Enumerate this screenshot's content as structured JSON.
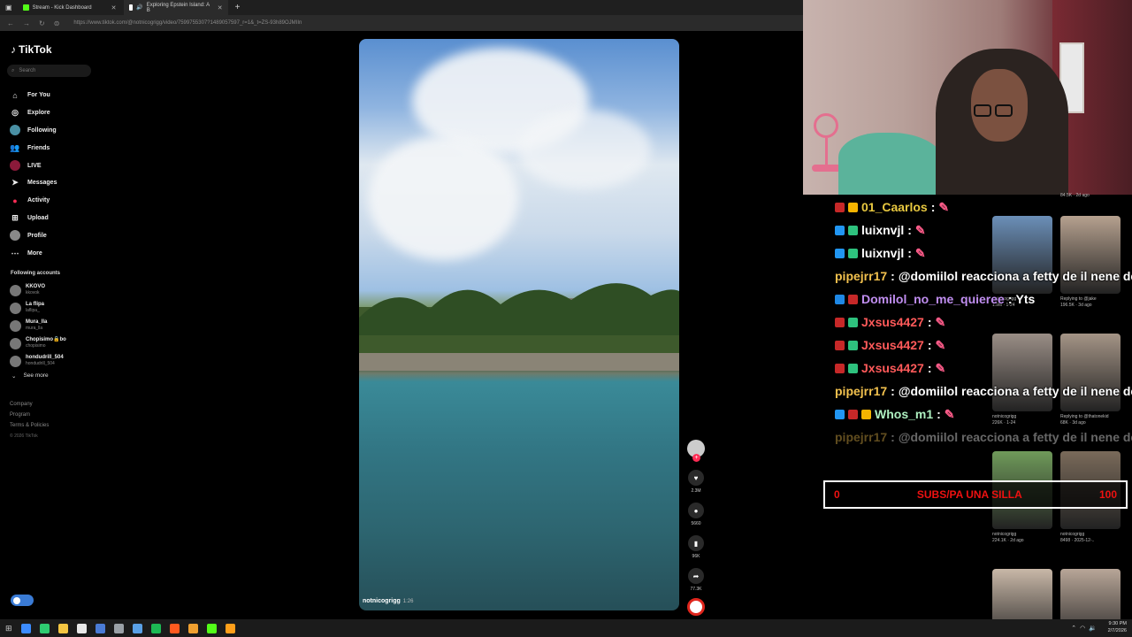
{
  "browser": {
    "tabs": [
      {
        "title": "Stream - Kick Dashboard",
        "fav_color": "#53fc18"
      },
      {
        "title": "Exploring Epstein Island: A B",
        "fav_color": "#ffffff"
      }
    ],
    "new_tab": "+",
    "url": "https://www.tiktok.com/@notnicogrigg/video/7599755307?1489057597_r=1&_t=ZS-93h89OJMIIn"
  },
  "tiktok": {
    "logo": "TikTok",
    "search_placeholder": "Search",
    "nav": [
      {
        "label": "For You",
        "icon": "home-icon"
      },
      {
        "label": "Explore",
        "icon": "compass-icon"
      },
      {
        "label": "Following",
        "icon": "following-icon"
      },
      {
        "label": "Friends",
        "icon": "friends-icon"
      },
      {
        "label": "LIVE",
        "icon": "live-icon"
      },
      {
        "label": "Messages",
        "icon": "messages-icon"
      },
      {
        "label": "Activity",
        "icon": "activity-icon"
      },
      {
        "label": "Upload",
        "icon": "upload-icon"
      },
      {
        "label": "Profile",
        "icon": "profile-icon"
      },
      {
        "label": "More",
        "icon": "more-icon"
      }
    ],
    "following_title": "Following accounts",
    "following": [
      {
        "name": "KKOVO",
        "handle": "kkovok"
      },
      {
        "name": "La flipa",
        "handle": "laflipa_"
      },
      {
        "name": "Mura_lla",
        "handle": "mura_lla"
      },
      {
        "name": "Chopisimo🔒bo",
        "handle": "chopisimo"
      },
      {
        "name": "hondudrill_504",
        "handle": "hondudrill_504"
      }
    ],
    "see_more": "See more",
    "footer": [
      "Company",
      "Program",
      "Terms & Policies"
    ],
    "copyright": "© 2026 TikTok",
    "video": {
      "author": "notnicogrigg",
      "duration": "1:26"
    },
    "actions": {
      "likes": "2.3M",
      "comments": "5660",
      "saves": "96K",
      "shares": "77.3K"
    }
  },
  "chat": [
    {
      "user": "01_Caarlos",
      "color": "#e8c840",
      "text": "",
      "badges": [
        "#c62828",
        "#f5b400"
      ]
    },
    {
      "user": "luixnvjl",
      "color": "#ffffff",
      "text": "",
      "badges": [
        "#2196f3",
        "#2ec27e"
      ]
    },
    {
      "user": "luixnvjl",
      "color": "#ffffff",
      "text": "",
      "badges": [
        "#2196f3",
        "#2ec27e"
      ]
    },
    {
      "user": "pipejrr17",
      "color": "#f2c14e",
      "text": "@domiilol reacciona a fetty de il nene de c",
      "badges": []
    },
    {
      "user": "Domilol_no_me_quieree",
      "color": "#c08ef0",
      "text": "Yts",
      "badges": [
        "#1e88e5",
        "#c62828"
      ]
    },
    {
      "user": "Jxsus4427",
      "color": "#ff5a5a",
      "text": "",
      "badges": [
        "#c62828",
        "#2ec27e"
      ]
    },
    {
      "user": "Jxsus4427",
      "color": "#ff5a5a",
      "text": "",
      "badges": [
        "#c62828",
        "#2ec27e"
      ]
    },
    {
      "user": "Jxsus4427",
      "color": "#ff5a5a",
      "text": "",
      "badges": [
        "#c62828",
        "#2ec27e"
      ]
    },
    {
      "user": "pipejrr17",
      "color": "#f2c14e",
      "text": "@domiilol reacciona a fetty de il nene de c",
      "badges": []
    },
    {
      "user": "Whos_m1",
      "color": "#aef0c0",
      "text": "",
      "badges": [
        "#2196f3",
        "#c62828",
        "#f5b400"
      ]
    },
    {
      "user": "pipejrr17",
      "color": "#f2c14e",
      "text": "@domiilol reacciona a fetty de il nene de c",
      "badges": [],
      "faded": true
    }
  ],
  "subs_bar": {
    "count": "0",
    "label": "SUBS/PA UNA SILLA",
    "goal": "100"
  },
  "thumbnails": [
    {
      "meta": "84.5K · 2d ago",
      "author": "",
      "color": "#caa58a",
      "col": 1,
      "row": -1
    },
    {
      "meta": "1.9M · 1-24",
      "author": "notnicogrigg",
      "color": "#6b8fb8",
      "col": 0,
      "row": 0
    },
    {
      "meta": "196.5K · 3d ago",
      "author": "Replying to @jake",
      "color": "#b6a18f",
      "col": 1,
      "row": 0
    },
    {
      "meta": "226K · 1-24",
      "author": "notnicogrigg",
      "color": "#9a8e86",
      "col": 0,
      "row": 1
    },
    {
      "meta": "68K · 3d ago",
      "author": "Replying to @thatonekid",
      "color": "#a49486",
      "col": 1,
      "row": 1
    },
    {
      "meta": "224.1K · 2d ago",
      "author": "notnicogrigg",
      "color": "#6f9a5a",
      "col": 0,
      "row": 2
    },
    {
      "meta": "8498 · 2025-12-..",
      "author": "notnicogrigg",
      "color": "#7a6a5a",
      "col": 1,
      "row": 2
    },
    {
      "meta": "",
      "author": "",
      "color": "#c9b8a8",
      "col": 0,
      "row": 3
    },
    {
      "meta": "",
      "author": "",
      "color": "#b8a698",
      "col": 1,
      "row": 3
    }
  ],
  "taskbar": {
    "time": "9:30 PM",
    "date": "2/7/2026",
    "apps": [
      "#3c8cff",
      "#2ecc71",
      "#f4c542",
      "#e8e8e8",
      "#4a7bd6",
      "#9aa0a6",
      "#5aa0e6",
      "#1db954",
      "#ff5a1f",
      "#f0a030",
      "#53fc18",
      "#ff9f1a"
    ]
  }
}
